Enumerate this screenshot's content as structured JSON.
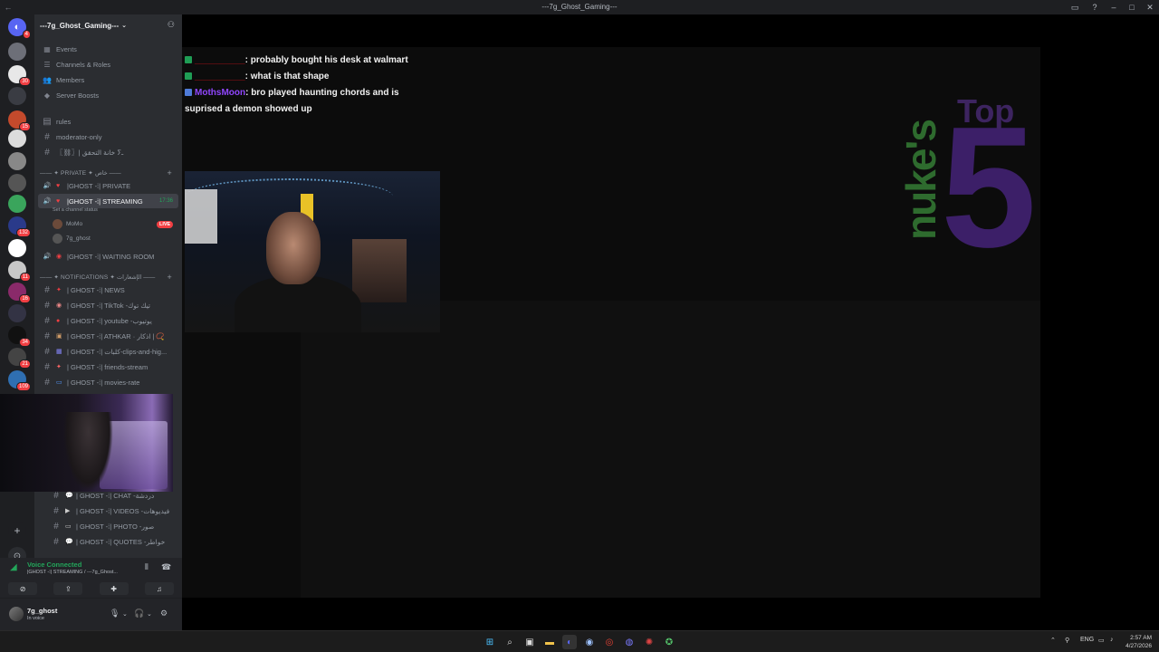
{
  "window": {
    "title": "---7g_Ghost_Gaming---",
    "back_glyph": "←",
    "btn_inbox": "▭",
    "btn_help": "?",
    "btn_min": "–",
    "btn_max": "□",
    "btn_close": "✕"
  },
  "rail": {
    "servers": [
      {
        "icon": "discord-home-icon",
        "glyph": "◐",
        "color": "#5865f2",
        "badge": "4"
      },
      {
        "icon": "server-avatar",
        "glyph": "",
        "color": "#6d6f78",
        "badge": ""
      },
      {
        "icon": "server-avatar",
        "glyph": "",
        "color": "#e8e8e8",
        "badge": "30"
      },
      {
        "icon": "server-avatar",
        "glyph": "",
        "color": "#3a3c43",
        "badge": ""
      },
      {
        "icon": "server-avatar",
        "glyph": "",
        "color": "#c44a2c",
        "badge": "15"
      },
      {
        "icon": "server-avatar",
        "glyph": "",
        "color": "#dcdcdc",
        "badge": ""
      },
      {
        "icon": "server-avatar",
        "glyph": "",
        "color": "#888",
        "badge": ""
      },
      {
        "icon": "server-avatar",
        "glyph": "",
        "color": "#555",
        "badge": ""
      },
      {
        "icon": "server-avatar",
        "glyph": "",
        "color": "#3aa55c",
        "badge": ""
      },
      {
        "icon": "server-avatar",
        "glyph": "",
        "color": "#2a3a8a",
        "badge": "132"
      },
      {
        "icon": "server-avatar",
        "glyph": "",
        "color": "#ffffff",
        "badge": ""
      },
      {
        "icon": "server-avatar",
        "glyph": "",
        "color": "#c8c8c8",
        "badge": "11"
      },
      {
        "icon": "server-avatar",
        "glyph": "",
        "color": "#8a2a6a",
        "badge": "16"
      },
      {
        "icon": "server-avatar",
        "glyph": "",
        "color": "#334",
        "badge": ""
      },
      {
        "icon": "server-avatar",
        "glyph": "",
        "color": "#111",
        "badge": "34"
      },
      {
        "icon": "server-avatar",
        "glyph": "",
        "color": "#444",
        "badge": "21"
      },
      {
        "icon": "server-avatar",
        "glyph": "",
        "color": "#2f6fb2",
        "badge": "109"
      }
    ],
    "add_server": "+",
    "discover": "⊙"
  },
  "sidebar": {
    "server_name": "---7g_Ghost_Gaming---",
    "top_items": [
      {
        "label": "Events",
        "icon": "calendar-icon",
        "glyph": "▦"
      },
      {
        "label": "Channels & Roles",
        "icon": "list-icon",
        "glyph": "☰"
      },
      {
        "label": "Members",
        "icon": "members-icon",
        "glyph": "👥"
      },
      {
        "label": "Server Boosts",
        "icon": "boost-icon",
        "glyph": "◆"
      }
    ],
    "channels_a": [
      {
        "label": "rules",
        "icon": "book-icon",
        "glyph": "▤"
      },
      {
        "label": "moderator-only",
        "icon": "hash-icon",
        "glyph": "#"
      },
      {
        "label": "〖⛓〗| خانة التحقق ⵢـ",
        "icon": "hash-icon",
        "glyph": "#"
      }
    ],
    "private_category": "—— ✦ PRIVATE ✦ خاص ——",
    "voice_channels": [
      {
        "label": "|GHOST -⁞| PRIVATE",
        "emoji": "♥"
      },
      {
        "label": "|GHOST -⁞| STREAMING",
        "emoji": "♥",
        "time": "17:36",
        "sub": "Set a channel status"
      },
      {
        "label": "|GHOST -⁞| WAITING ROOM",
        "emoji": "◉"
      }
    ],
    "members": [
      {
        "name": "MoMo",
        "live": "LIVE"
      },
      {
        "name": "7g_ghost",
        "live": ""
      }
    ],
    "notif_category": "—— ✦ NOTIFICATIONS ✦ الإشعارات ——",
    "channels_b": [
      {
        "label": "| GHOST -⁞| NEWS",
        "emoji": "✦"
      },
      {
        "label": "| GHOST -⁞| TikTok -تيك توك",
        "emoji": "◉"
      },
      {
        "label": "| GHOST -⁞| youtube -يوتيوب",
        "emoji": "●"
      },
      {
        "label": "| GHOST -⁞| ATHKAR · اذكار | 📿",
        "emoji": "▣"
      },
      {
        "label": "| GHOST -⁞| كلبات-clips-and-hig...",
        "emoji": "▦"
      },
      {
        "label": "| GHOST -⁞| friends-stream",
        "emoji": "✦"
      },
      {
        "label": "| GHOST -⁞| movies-rate",
        "emoji": "▭"
      }
    ],
    "channels_c": [
      {
        "label": "| GHOST -⁞| CHAT -دردشة",
        "emoji": "💬"
      },
      {
        "label": "| GHOST -⁞| VIDEOS -فيديوهات",
        "emoji": "▶"
      },
      {
        "label": "| GHOST -⁞| PHOTO -صور",
        "emoji": "▭"
      },
      {
        "label": "| GHOST -⁞| QUOTES -خواطر",
        "emoji": "💬"
      }
    ]
  },
  "voice": {
    "status": "Voice Connected",
    "channel": "|GHOST -⁞| STREAMING / ---7g_Ghost...",
    "btn_camera": "⊘",
    "btn_share": "⇪",
    "btn_activity": "✚",
    "btn_sound": "♫"
  },
  "user": {
    "name": "7g_ghost",
    "status": "In voice"
  },
  "stream": {
    "chat": [
      {
        "user": "__________",
        "text": "probably bought his desk at walmart",
        "style": "u1"
      },
      {
        "user": "__________",
        "text": "what is that shape",
        "style": "u1"
      },
      {
        "user": "MothsMoon",
        "text": "bro played haunting chords and is suprised a demon showed up",
        "style": "u2"
      }
    ],
    "logo_word": "nuke's",
    "logo_top": "Top",
    "logo_num": "5"
  },
  "taskbar": {
    "lang": "ENG",
    "time": "2:57 AM",
    "date": "4/27/2026"
  }
}
